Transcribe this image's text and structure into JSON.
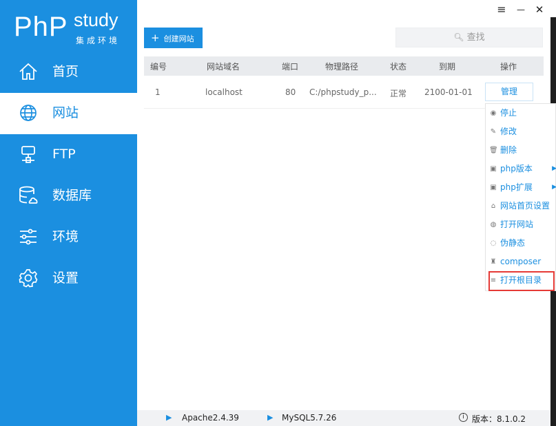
{
  "app": {
    "logo_php": "PhP",
    "logo_study": "study",
    "logo_sub": "集成环境"
  },
  "window_controls": {
    "menu": "≡",
    "minimize": "—",
    "close": "✕"
  },
  "sidebar": {
    "items": [
      {
        "label": "首页",
        "icon": "home-icon"
      },
      {
        "label": "网站",
        "icon": "globe-icon",
        "active": true
      },
      {
        "label": "FTP",
        "icon": "ftp-server-icon"
      },
      {
        "label": "数据库",
        "icon": "database-icon"
      },
      {
        "label": "环境",
        "icon": "sliders-icon"
      },
      {
        "label": "设置",
        "icon": "gear-icon"
      }
    ]
  },
  "toolbar": {
    "create_label": "创建网站",
    "search_placeholder": "查找"
  },
  "table": {
    "headers": [
      "编号",
      "网站域名",
      "端口",
      "物理路径",
      "状态",
      "到期",
      "操作"
    ],
    "rows": [
      {
        "id": "1",
        "domain": "localhost",
        "port": "80",
        "path": "C:/phpstudy_p...",
        "status": "正常",
        "expiry": "2100-01-01",
        "action": "管理"
      }
    ]
  },
  "context_menu": {
    "items": [
      {
        "label": "停止",
        "icon": "stop-icon"
      },
      {
        "label": "修改",
        "icon": "pencil-icon"
      },
      {
        "label": "删除",
        "icon": "trash-icon"
      },
      {
        "label": "php版本",
        "icon": "php-version-icon",
        "submenu": true
      },
      {
        "label": "php扩展",
        "icon": "php-extension-icon",
        "submenu": true
      },
      {
        "label": "网站首页设置",
        "icon": "home-icon"
      },
      {
        "label": "打开网站",
        "icon": "globe-icon"
      },
      {
        "label": "伪静态",
        "icon": "rewrite-icon"
      },
      {
        "label": "composer",
        "icon": "composer-icon"
      },
      {
        "label": "打开根目录",
        "icon": "list-icon",
        "highlighted": true
      }
    ]
  },
  "footer": {
    "apache": "Apache2.4.39",
    "mysql": "MySQL5.7.26",
    "version": "版本：8.1.0.2"
  },
  "colors": {
    "accent": "#1b8fe0",
    "highlight": "#e53935"
  }
}
